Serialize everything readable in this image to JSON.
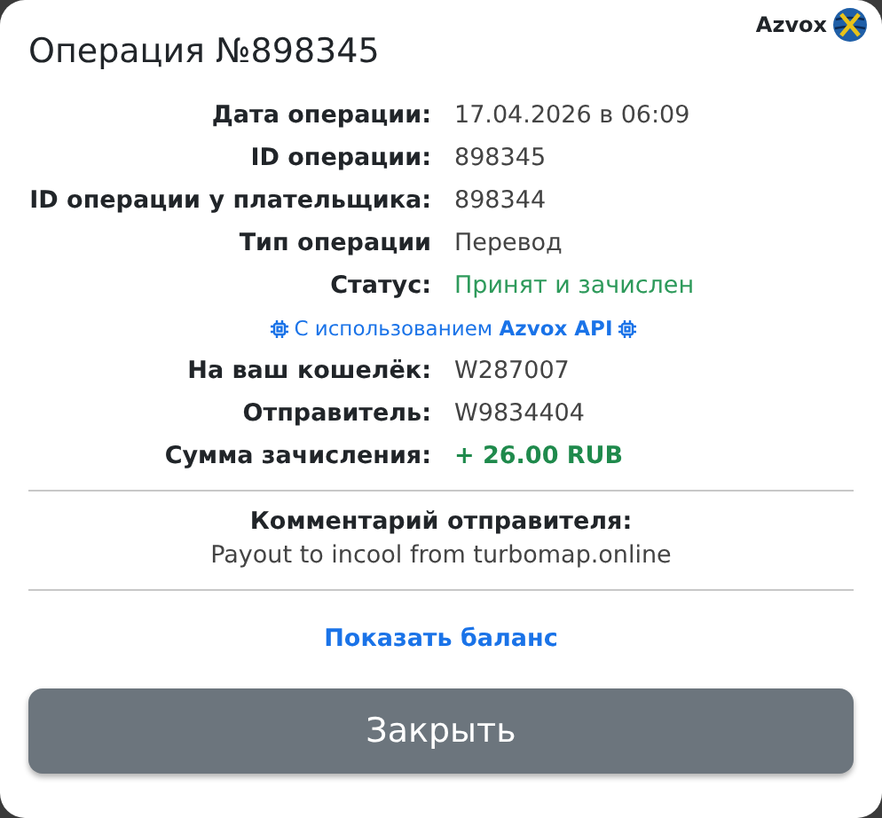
{
  "brand": {
    "name": "Azvox"
  },
  "title": "Операция №898345",
  "rows": [
    {
      "kind": "field",
      "label": "Дата операции:",
      "value": "17.04.2026 в 06:09"
    },
    {
      "kind": "field",
      "label": "ID операции:",
      "value": "898345"
    },
    {
      "kind": "field",
      "label": "ID операции у плательщика:",
      "value": "898344"
    },
    {
      "kind": "field",
      "label": "Тип операции",
      "value": "Перевод"
    },
    {
      "kind": "status",
      "label": "Статус:",
      "value": "Принят и зачислен"
    },
    {
      "kind": "api",
      "text": "С использованием **Azvox API**"
    },
    {
      "kind": "field",
      "label": "На ваш кошелёк:",
      "value": "W287007"
    },
    {
      "kind": "field",
      "label": "Отправитель:",
      "value": "W9834404"
    },
    {
      "kind": "amount",
      "label": "Сумма зачисления:",
      "value": "+ 26.00 RUB"
    }
  ],
  "comment": {
    "heading": "Комментарий отправителя:",
    "text": "Payout to incool from turbomap.online"
  },
  "link": "Показать баланс",
  "close_button": "Закрыть"
}
